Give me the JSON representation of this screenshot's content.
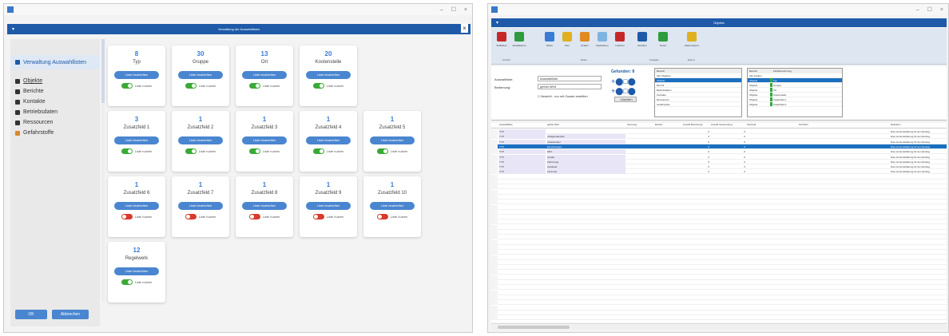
{
  "left": {
    "controls": {
      "minimize": "–",
      "maximize": "☐",
      "close": "×"
    },
    "title": "Verwaltung der Auswahllisten",
    "dialog_close": "×",
    "sidebar": {
      "header": "Verwaltung Auswahllisten",
      "items": [
        "Objekte",
        "Berichte",
        "Kontakte",
        "Betriebsdaten",
        "Ressourcen",
        "Gefahrstoffe"
      ]
    },
    "btn_label": "Liste bearbeiten",
    "toggle_label": "Liste nutzen",
    "cards": [
      {
        "count": "8",
        "name": "Typ",
        "on": true
      },
      {
        "count": "30",
        "name": "Gruppe",
        "on": true
      },
      {
        "count": "13",
        "name": "Ort",
        "on": true
      },
      {
        "count": "20",
        "name": "Kostenstelle",
        "on": true
      },
      {
        "count": "3",
        "name": "Zusatzfeld 1",
        "on": true
      },
      {
        "count": "1",
        "name": "Zusatzfeld 2",
        "on": true
      },
      {
        "count": "1",
        "name": "Zusatzfeld 3",
        "on": true
      },
      {
        "count": "1",
        "name": "Zusatzfeld 4",
        "on": true
      },
      {
        "count": "1",
        "name": "Zusatzfeld 5",
        "on": true
      },
      {
        "count": "1",
        "name": "Zusatzfeld 6",
        "on": false
      },
      {
        "count": "1",
        "name": "Zusatzfeld 7",
        "on": false
      },
      {
        "count": "1",
        "name": "Zusatzfeld 8",
        "on": false
      },
      {
        "count": "1",
        "name": "Zusatzfeld 9",
        "on": false
      },
      {
        "count": "1",
        "name": "Zusatzfeld 10",
        "on": false
      },
      {
        "count": "12",
        "name": "Regelwerk",
        "on": true
      }
    ],
    "ok": "OK",
    "cancel": "Abbrechen"
  },
  "right": {
    "controls": {
      "minimize": "–",
      "maximize": "☐",
      "close": "×"
    },
    "title": "Objekte",
    "ribbon": {
      "buttons": [
        "Schließen",
        "Aktualisieren",
        "Filtern",
        "Neu",
        "Ändern",
        "Duplizieren",
        "Löschen",
        "Drucken",
        "Excel",
        "Daten Export"
      ],
      "groups": [
        "Ansicht",
        "Daten",
        "Ausgabe",
        "Export"
      ]
    },
    "filter": {
      "label1": "Auswahlliste:",
      "value1": "Auswahlliste",
      "label2": "Bedienung:",
      "value2": "gelöst Wert",
      "checkbox": "Ansicht - nur mit Zusatz erstellen",
      "found": "Gefunden: 8",
      "list1": [
        "Alle Objekten",
        "Objekte",
        "Bericht",
        "Betriebsdaten",
        "Kontakte",
        "Ressourcen",
        "Gefahrstoffe"
      ],
      "list1_header": "Bereich",
      "list2_header": [
        "Bereich",
        "Feldbezeichnung"
      ],
      "list2": [
        [
          "Alle Feldern",
          ""
        ],
        [
          "Objekte",
          "Typ"
        ],
        [
          "Objekte",
          "Gruppe"
        ],
        [
          "Objekte",
          "Ort"
        ],
        [
          "Objekte",
          "Kostenstelle"
        ],
        [
          "Objekte",
          "Zusatzfeld 1"
        ],
        [
          "Objekte",
          "Zusatzfeld 2"
        ]
      ],
      "loeschen": "Löschen"
    },
    "grid": {
      "headers": [
        "Auswahlliste",
        "gelöst Wert",
        "Kennung",
        "Einheit",
        "Anzahl Benutzung",
        "Anzahl Verwendung",
        "Std Feld",
        "Std Wert",
        "Definition"
      ],
      "rows": [
        [
          "TYP",
          "",
          "",
          "",
          "0",
          "0",
          "",
          "",
          "Dies ist die Erklärung für den Eintrag"
        ],
        [
          "TYP",
          "Anlagenbauteile",
          "",
          "",
          "0",
          "0",
          "",
          "",
          "Dies ist die Erklärung für den Eintrag"
        ],
        [
          "TYP",
          "Arbeitsmittel",
          "",
          "",
          "0",
          "0",
          "",
          "",
          "Dies ist die Erklärung für den Eintrag"
        ],
        [
          "TYP",
          "Einrichtungen",
          "",
          "",
          "0",
          "0",
          "",
          "",
          "Dies ist die Erklärung für den Eintrag"
        ],
        [
          "TYP",
          "EDV",
          "",
          "",
          "0",
          "0",
          "",
          "",
          "Dies ist die Erklärung für den Eintrag"
        ],
        [
          "TYP",
          "Geräte",
          "",
          "",
          "0",
          "0",
          "",
          "",
          "Dies ist die Erklärung für den Eintrag"
        ],
        [
          "TYP",
          "Fahrzeuge",
          "",
          "",
          "0",
          "0",
          "",
          "",
          "Dies ist die Erklärung für den Eintrag"
        ],
        [
          "TYP",
          "Gebäude",
          "",
          "",
          "0",
          "0",
          "",
          "",
          "Dies ist die Erklärung für den Eintrag"
        ],
        [
          "TYP",
          "Personal",
          "",
          "",
          "0",
          "0",
          "",
          "",
          "Dies ist die Erklärung für den Eintrag"
        ]
      ],
      "selected_row": 3
    },
    "colors": {
      "accent": "#1e5aa8",
      "selected": "#1a6fc0"
    }
  }
}
